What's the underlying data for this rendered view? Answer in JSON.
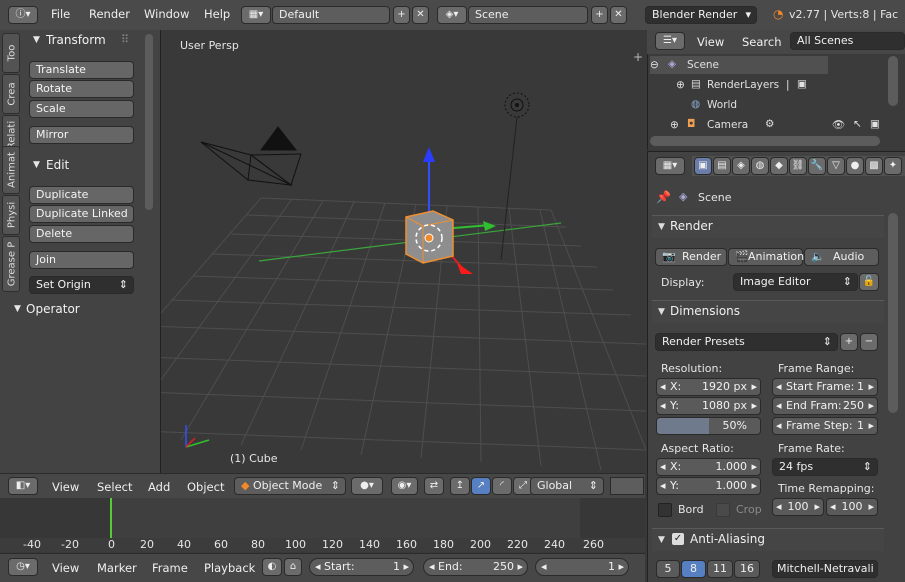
{
  "top_menu": {
    "items": [
      "File",
      "Render",
      "Window",
      "Help"
    ],
    "layout": "Default",
    "scene": "Scene",
    "engine": "Blender Render",
    "stats": "v2.77 | Verts:8 | Fac"
  },
  "tools": {
    "tabs": [
      "Too",
      "Crea",
      "Relati",
      "Animat",
      "Physi",
      "Grease P"
    ],
    "transform_title": "Transform",
    "transform": [
      "Translate",
      "Rotate",
      "Scale"
    ],
    "mirror": "Mirror",
    "edit_title": "Edit",
    "edit": [
      "Duplicate",
      "Duplicate Linked",
      "Delete"
    ],
    "join": "Join",
    "set_origin": "Set Origin",
    "operator_title": "Operator"
  },
  "viewport": {
    "label": "User Persp",
    "object": "(1) Cube"
  },
  "view_header": {
    "view": "View",
    "select": "Select",
    "add": "Add",
    "object": "Object",
    "mode": "Object Mode",
    "orientation": "Global"
  },
  "timeline": {
    "ticks": [
      "-40",
      "-20",
      "0",
      "20",
      "40",
      "60",
      "80",
      "100",
      "120",
      "140",
      "160",
      "180",
      "200",
      "220",
      "240",
      "260"
    ],
    "view": "View",
    "marker": "Marker",
    "frame": "Frame",
    "playback": "Playback",
    "start_label": "Start:",
    "start": "1",
    "end_label": "End:",
    "end": "250",
    "current": "1"
  },
  "outliner": {
    "view": "View",
    "search": "Search",
    "filter": "All Scenes",
    "items": [
      "Scene",
      "RenderLayers",
      "World",
      "Camera"
    ]
  },
  "properties": {
    "context": "Scene",
    "render_title": "Render",
    "render_btn": "Render",
    "animation_btn": "Animation",
    "audio_btn": "Audio",
    "display_label": "Display:",
    "display_value": "Image Editor",
    "dimensions_title": "Dimensions",
    "presets": "Render Presets",
    "resolution_label": "Resolution:",
    "res_x_label": "X:",
    "res_x": "1920 px",
    "res_y_label": "Y:",
    "res_y": "1080 px",
    "res_pct": "50%",
    "frame_range_label": "Frame Range:",
    "start_frame_label": "Start Frame:",
    "start_frame": "1",
    "end_frame_label": "End Fram:",
    "end_frame": "250",
    "frame_step_label": "Frame Step:",
    "frame_step": "1",
    "aspect_label": "Aspect Ratio:",
    "aspect_x_label": "X:",
    "aspect_x": "1.000",
    "aspect_y_label": "Y:",
    "aspect_y": "1.000",
    "frame_rate_label": "Frame Rate:",
    "fps": "24 fps",
    "time_remap_label": "Time Remapping:",
    "remap_old": "100",
    "remap_new": "100",
    "border": "Bord",
    "crop": "Crop",
    "aa_title": "Anti-Aliasing",
    "aa_samples": [
      "5",
      "8",
      "11",
      "16"
    ],
    "aa_filter": "Mitchell-Netravali"
  }
}
